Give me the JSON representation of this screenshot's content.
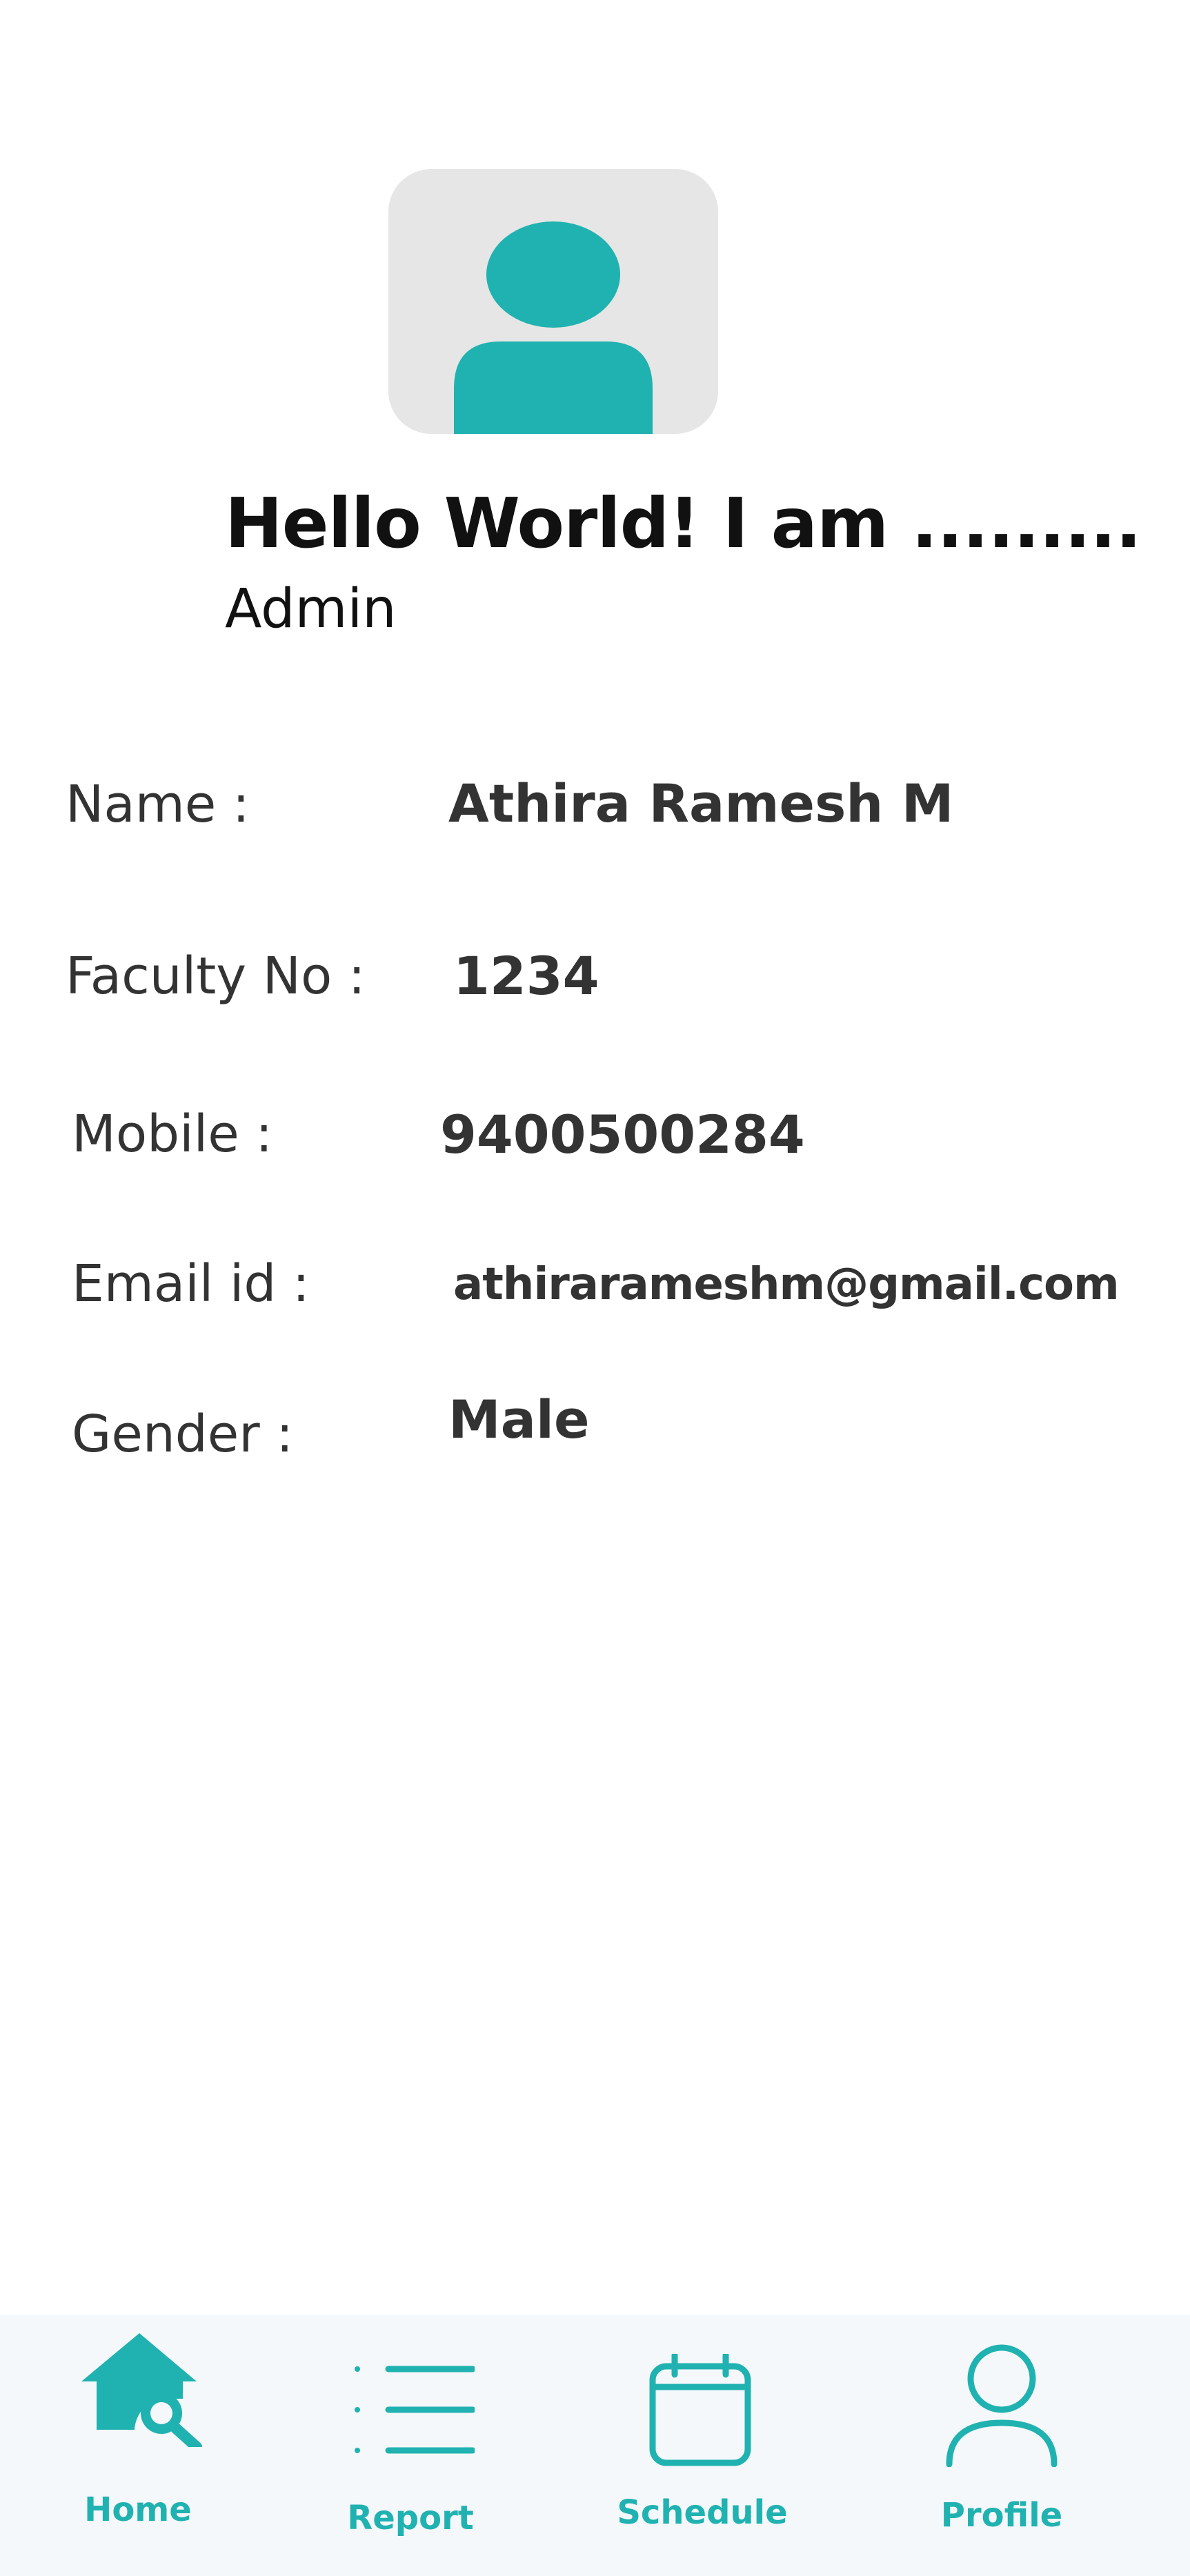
{
  "header": {
    "greeting": "Hello World! I am  .........",
    "role": "Admin"
  },
  "profile": {
    "name_label": "Name :",
    "name_value": "Athira Ramesh M",
    "faculty_label": "Faculty No :",
    "faculty_value": "1234",
    "mobile_label": "Mobile :",
    "mobile_value": "9400500284",
    "email_label": "Email id :",
    "email_value": "athirarameshm@gmail.com",
    "gender_label": "Gender :",
    "gender_value": "Male"
  },
  "nav": {
    "items": [
      {
        "label": "Home",
        "icon": "home-search-icon"
      },
      {
        "label": "Report",
        "icon": "list-icon"
      },
      {
        "label": "Schedule",
        "icon": "calendar-icon"
      },
      {
        "label": "Profile",
        "icon": "user-icon"
      }
    ]
  },
  "colors": {
    "accent": "#20b2b0",
    "avatar_bg": "#e6e6e6",
    "nav_bg": "#f4f8fb"
  }
}
